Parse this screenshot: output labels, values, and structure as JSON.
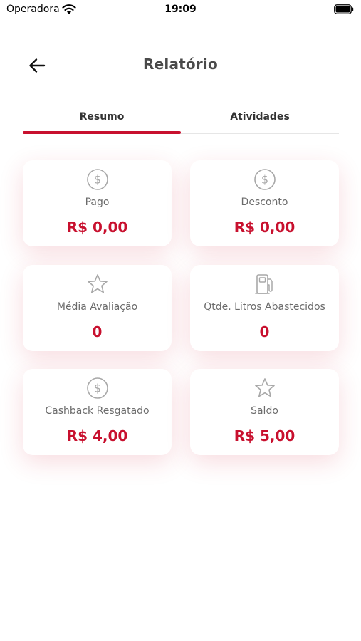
{
  "status_bar": {
    "carrier": "Operadora",
    "time": "19:09"
  },
  "header": {
    "title": "Relatório",
    "back_icon": "arrow-left-icon"
  },
  "tabs": [
    {
      "label": "Resumo",
      "active": true
    },
    {
      "label": "Atividades",
      "active": false
    }
  ],
  "cards": [
    {
      "icon": "dollar-circle-icon",
      "label": "Pago",
      "value": "R$ 0,00"
    },
    {
      "icon": "dollar-circle-icon",
      "label": "Desconto",
      "value": "R$ 0,00"
    },
    {
      "icon": "star-icon",
      "label": "Média Avaliação",
      "value": "0"
    },
    {
      "icon": "fuel-pump-icon",
      "label": "Qtde. Litros Abastecidos",
      "value": "0"
    },
    {
      "icon": "dollar-circle-icon",
      "label": "Cashback Resgatado",
      "value": "R$ 4,00"
    },
    {
      "icon": "star-icon",
      "label": "Saldo",
      "value": "R$ 5,00"
    }
  ],
  "colors": {
    "accent": "#c8102e",
    "title": "#4a4a4a",
    "label": "#6b6b6b"
  }
}
